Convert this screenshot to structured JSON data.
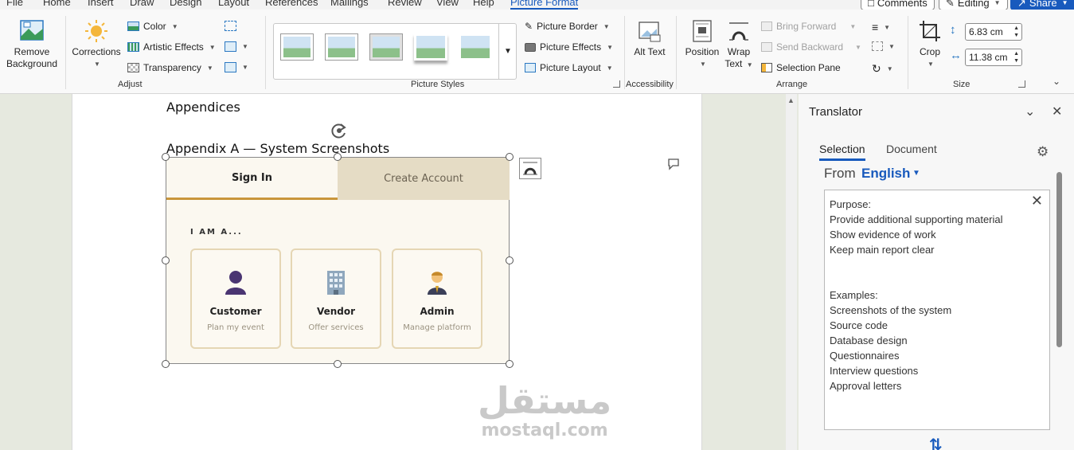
{
  "menu": {
    "tabs": [
      "File",
      "Home",
      "Insert",
      "Draw",
      "Design",
      "Layout",
      "References",
      "Mailings",
      "Review",
      "View",
      "Help",
      "Picture Format"
    ],
    "active_tab": "Picture Format",
    "comments_label": "Comments",
    "editing_label": "Editing",
    "share_label": "Share"
  },
  "ribbon": {
    "adjust": {
      "remove_background": "Remove Background",
      "corrections": "Corrections",
      "color": "Color",
      "artistic_effects": "Artistic Effects",
      "transparency": "Transparency",
      "group_label": "Adjust"
    },
    "picture_styles": {
      "picture_border": "Picture Border",
      "picture_effects": "Picture Effects",
      "picture_layout": "Picture Layout",
      "group_label": "Picture Styles"
    },
    "accessibility": {
      "alt_text": "Alt Text",
      "group_label": "Accessibility"
    },
    "arrange": {
      "position": "Position",
      "wrap_text": "Wrap Text",
      "bring_forward": "Bring Forward",
      "send_backward": "Send Backward",
      "selection_pane": "Selection Pane",
      "group_label": "Arrange"
    },
    "size": {
      "crop": "Crop",
      "height": "6.83 cm",
      "width": "11.38 cm",
      "group_label": "Size"
    }
  },
  "document": {
    "heading": "Appendices",
    "subheading": "Appendix A — System Screenshots",
    "screenshot": {
      "tab_sign_in": "Sign In",
      "tab_create": "Create Account",
      "prompt": "I AM A...",
      "roles": [
        {
          "name": "Customer",
          "desc": "Plan my event"
        },
        {
          "name": "Vendor",
          "desc": "Offer services"
        },
        {
          "name": "Admin",
          "desc": "Manage platform"
        }
      ]
    },
    "watermark_arabic": "مستقل",
    "watermark_latin": "mostaql.com"
  },
  "translator": {
    "title": "Translator",
    "tabs": [
      "Selection",
      "Document"
    ],
    "from_label": "From",
    "from_language": "English",
    "source_lines": [
      "Purpose:",
      "Provide additional supporting material",
      "Show evidence of work",
      "Keep main report clear",
      "",
      "",
      "Examples:",
      "Screenshots of the system",
      "Source code",
      "Database design",
      "Questionnaires",
      "Interview questions",
      "Approval letters"
    ]
  },
  "colors": {
    "accent": "#185abd",
    "tab_underline": "#c9963b",
    "create_tab_bg": "#e5dcc5"
  }
}
